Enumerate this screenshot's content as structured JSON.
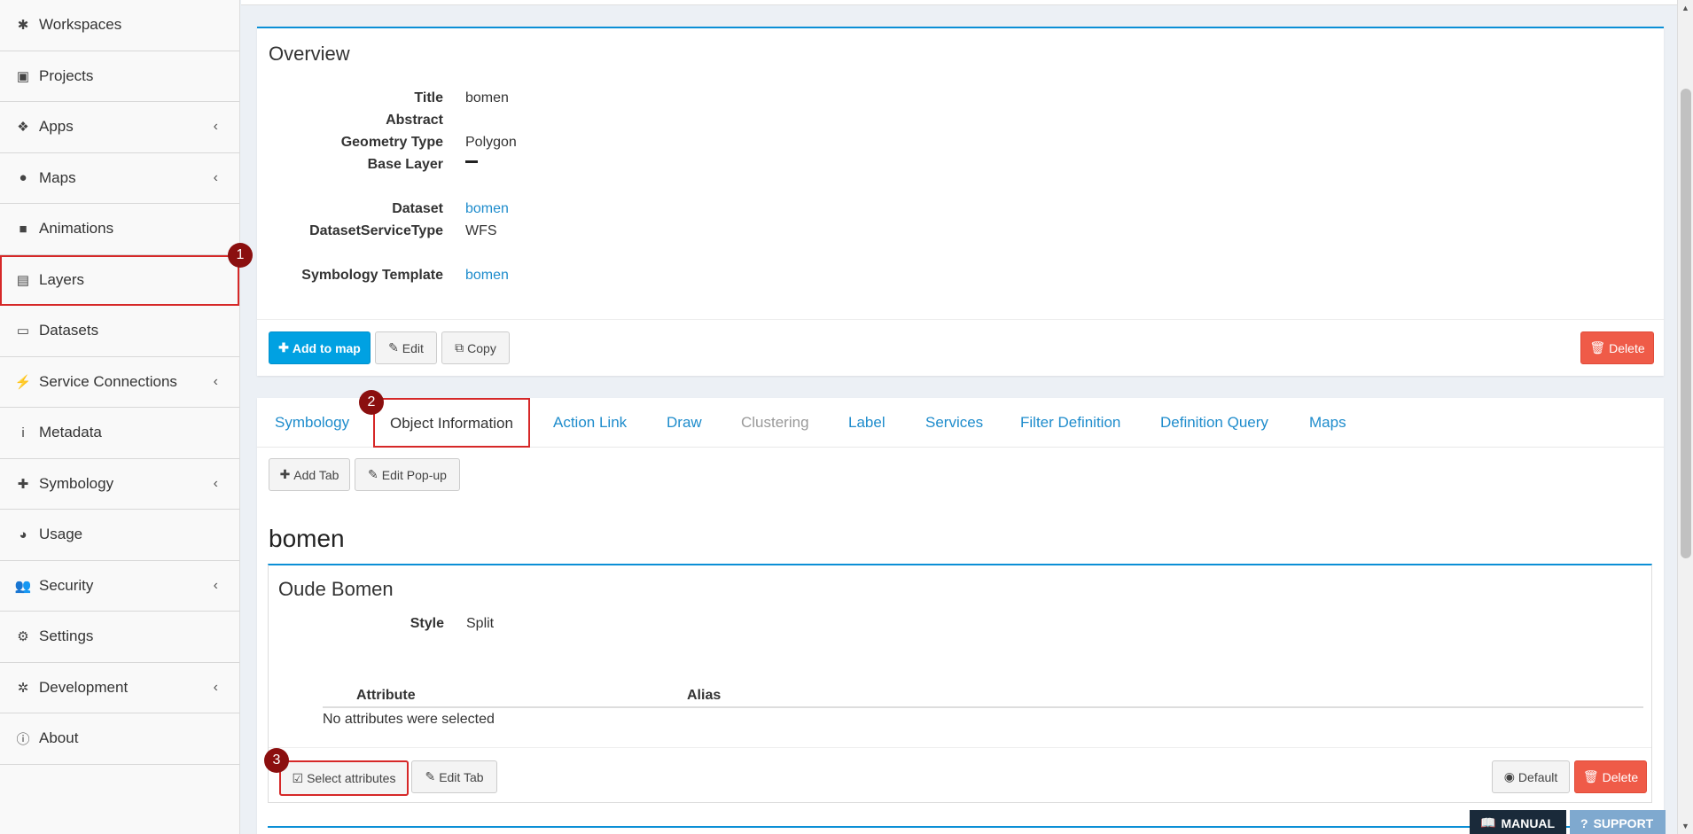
{
  "sidebar": {
    "items": [
      {
        "label": "Workspaces",
        "icon": "asterisk-icon",
        "glyph": "✱",
        "chevron": false
      },
      {
        "label": "Projects",
        "icon": "briefcase-icon",
        "glyph": "▣",
        "chevron": false
      },
      {
        "label": "Apps",
        "icon": "cubes-icon",
        "glyph": "❖",
        "chevron": true
      },
      {
        "label": "Maps",
        "icon": "globe-icon",
        "glyph": "●",
        "chevron": true
      },
      {
        "label": "Animations",
        "icon": "video-camera-icon",
        "glyph": "■",
        "chevron": false
      },
      {
        "label": "Layers",
        "icon": "map-icon",
        "glyph": "▤",
        "chevron": false
      },
      {
        "label": "Datasets",
        "icon": "hdd-icon",
        "glyph": "▭",
        "chevron": false
      },
      {
        "label": "Service Connections",
        "icon": "plug-icon",
        "glyph": "⚡",
        "chevron": true
      },
      {
        "label": "Metadata",
        "icon": "info-icon",
        "glyph": "i",
        "chevron": false
      },
      {
        "label": "Symbology",
        "icon": "puzzle-icon",
        "glyph": "✚",
        "chevron": true
      },
      {
        "label": "Usage",
        "icon": "pie-chart-icon",
        "glyph": "◕",
        "chevron": false
      },
      {
        "label": "Security",
        "icon": "users-icon",
        "glyph": "👥",
        "chevron": true
      },
      {
        "label": "Settings",
        "icon": "gear-icon",
        "glyph": "⚙",
        "chevron": false
      },
      {
        "label": "Development",
        "icon": "bug-icon",
        "glyph": "✲",
        "chevron": true
      },
      {
        "label": "About",
        "icon": "info-circle-icon",
        "glyph": "ⓘ",
        "chevron": false
      }
    ],
    "chevron_glyph": "‹"
  },
  "badges": {
    "one": "1",
    "two": "2",
    "three": "3"
  },
  "overview": {
    "title": "Overview",
    "fields": {
      "title_label": "Title",
      "title_value": "bomen",
      "abstract_label": "Abstract",
      "geometry_label": "Geometry Type",
      "geometry_value": "Polygon",
      "baselayer_label": "Base Layer",
      "dataset_label": "Dataset",
      "dataset_value": "bomen",
      "dst_label": "DatasetServiceType",
      "dst_value": "WFS",
      "symbology_label": "Symbology Template",
      "symbology_value": "bomen"
    },
    "buttons": {
      "add_to_map": "Add to map",
      "edit": "Edit",
      "copy": "Copy",
      "delete": "Delete"
    }
  },
  "tabs": [
    {
      "label": "Symbology",
      "state": "normal"
    },
    {
      "label": "Object Information",
      "state": "active"
    },
    {
      "label": "Action Link",
      "state": "normal"
    },
    {
      "label": "Draw",
      "state": "normal"
    },
    {
      "label": "Clustering",
      "state": "disabled"
    },
    {
      "label": "Label",
      "state": "normal"
    },
    {
      "label": "Services",
      "state": "normal"
    },
    {
      "label": "Filter Definition",
      "state": "normal"
    },
    {
      "label": "Definition Query",
      "state": "normal"
    },
    {
      "label": "Maps",
      "state": "normal"
    }
  ],
  "object_info": {
    "buttons": {
      "add_tab": "Add Tab",
      "edit_popup": "Edit Pop-up"
    },
    "section_title": "bomen",
    "panel": {
      "title": "Oude Bomen",
      "style_label": "Style",
      "style_value": "Split",
      "table": {
        "col_attribute": "Attribute",
        "col_alias": "Alias",
        "empty": "No attributes were selected"
      },
      "buttons": {
        "select_attributes": "Select attributes",
        "edit_tab": "Edit Tab",
        "default": "Default",
        "delete": "Delete"
      }
    }
  },
  "footer_buttons": {
    "manual": "MANUAL",
    "support": "SUPPORT"
  },
  "colors": {
    "accent": "#00a1e2",
    "danger": "#ef5b48",
    "link": "#1e8ccc",
    "highlight": "#d62828",
    "badge": "#8b0f0f"
  }
}
